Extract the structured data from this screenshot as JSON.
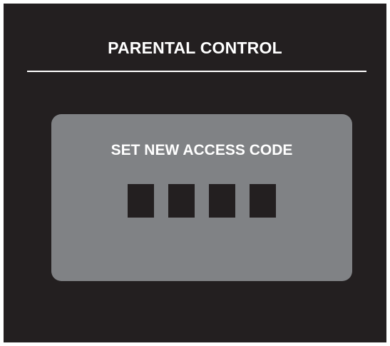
{
  "screen": {
    "title": "PARENTAL CONTROL",
    "background_color": "#231f20"
  },
  "dialog": {
    "title": "SET NEW ACCESS CODE",
    "background_color": "#808285",
    "code_digits": [
      "",
      "",
      "",
      ""
    ]
  }
}
